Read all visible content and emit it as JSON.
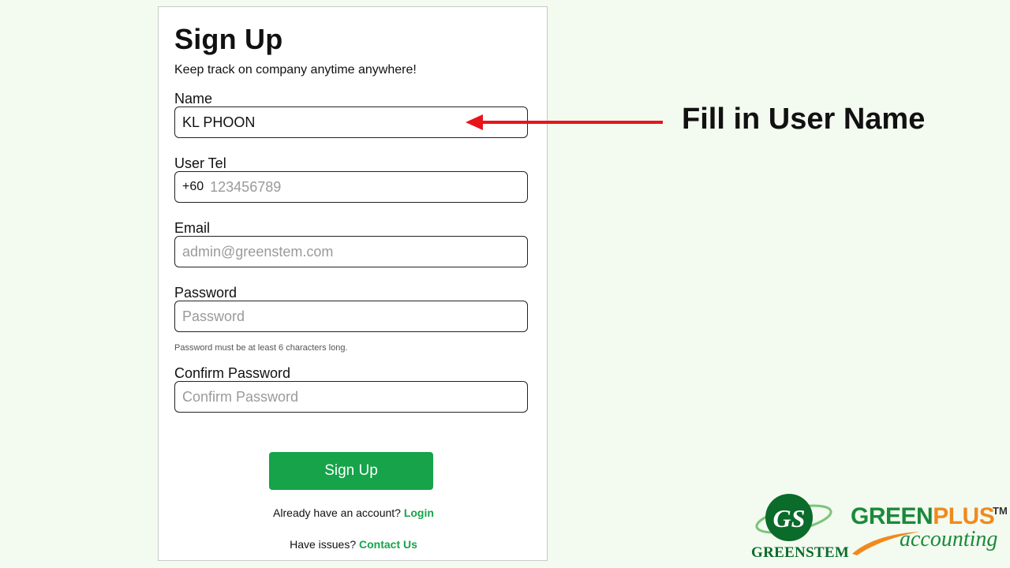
{
  "form": {
    "title": "Sign Up",
    "subtitle": "Keep track on company anytime anywhere!",
    "name_label": "Name",
    "name_value": "KL PHOON",
    "tel_label": "User Tel",
    "tel_prefix": "+60",
    "tel_placeholder": "123456789",
    "email_label": "Email",
    "email_placeholder": "admin@greenstem.com",
    "password_label": "Password",
    "password_placeholder": "Password",
    "password_hint": "Password must be at least 6 characters long.",
    "confirm_label": "Confirm Password",
    "confirm_placeholder": "Confirm Password",
    "submit_label": "Sign Up",
    "login_prompt": "Already have an account?",
    "login_link": "Login",
    "issues_prompt": "Have issues?",
    "contact_link": "Contact Us"
  },
  "annotation": {
    "text": "Fill in User Name",
    "arrow_color": "#e8141c"
  },
  "branding": {
    "greenstem_monogram": "GS",
    "greenstem_word": "GREENSTEM",
    "greenplus_green": "GREEN",
    "greenplus_orange": "PLUS",
    "trademark": "TM",
    "accounting": "accounting"
  },
  "colors": {
    "accent_green": "#16a34a",
    "background": "#f3faf0"
  },
  "icons": {
    "arrow": "left-arrow-icon",
    "greenstem_logo": "greenstem-logo-icon",
    "swoosh": "orange-swoosh-icon"
  }
}
